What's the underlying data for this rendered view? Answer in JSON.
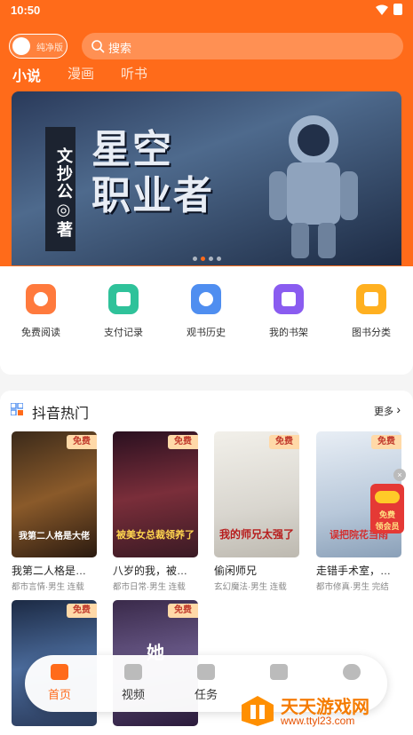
{
  "status_bar": {
    "time": "10:50"
  },
  "header": {
    "toggle_label": "纯净版",
    "search_placeholder": "搜索",
    "tabs": [
      "小说",
      "漫画",
      "听书"
    ]
  },
  "banner": {
    "author": "文抄公◎著",
    "title_line1": "星空",
    "title_line2": "职业者",
    "dots": 4,
    "active_dot": 2
  },
  "menu": [
    {
      "label": "免费阅读",
      "icon": "free-read-icon",
      "color": "#ff7a3d"
    },
    {
      "label": "支付记录",
      "icon": "payment-record-icon",
      "color": "#2fc29a"
    },
    {
      "label": "观书历史",
      "icon": "history-clock-icon",
      "color": "#4f8ef0"
    },
    {
      "label": "我的书架",
      "icon": "bookshelf-icon",
      "color": "#8a5cf0"
    },
    {
      "label": "图书分类",
      "icon": "category-icon",
      "color": "#ffb020"
    }
  ],
  "section": {
    "title": "抖音热门",
    "more": "更多"
  },
  "books": [
    {
      "title": "我第二人格是…",
      "meta": "都市言情·男生 连载",
      "badge": "免费",
      "cover_text": "我第二人格是大佬"
    },
    {
      "title": "八岁的我，被…",
      "meta": "都市日常·男生 连载",
      "badge": "免费",
      "cover_text": "被美女总裁领养了"
    },
    {
      "title": "偷闲师兄",
      "meta": "玄幻魔法·男生 连载",
      "badge": "免费",
      "cover_text": "我的师兄太强了"
    },
    {
      "title": "走错手术室，…",
      "meta": "都市修真·男生 完结",
      "badge": "免费",
      "cover_text": "误把院花当雨"
    },
    {
      "title": "",
      "meta": "",
      "badge": "免费",
      "cover_text": ""
    },
    {
      "title": "",
      "meta": "",
      "badge": "免费",
      "cover_text": "她"
    }
  ],
  "red_packet": {
    "label": "免费\n领会员"
  },
  "bottom_nav": [
    {
      "label": "首页",
      "icon": "home-book-icon",
      "active": true
    },
    {
      "label": "视频",
      "icon": "video-play-icon",
      "active": false
    },
    {
      "label": "任务",
      "icon": "gift-icon",
      "active": false
    },
    {
      "label": "",
      "icon": "ticket-icon",
      "active": false
    },
    {
      "label": "",
      "icon": "profile-icon",
      "active": false
    }
  ],
  "watermark": {
    "title": "天天游戏网",
    "url": "www.ttyl23.com"
  }
}
